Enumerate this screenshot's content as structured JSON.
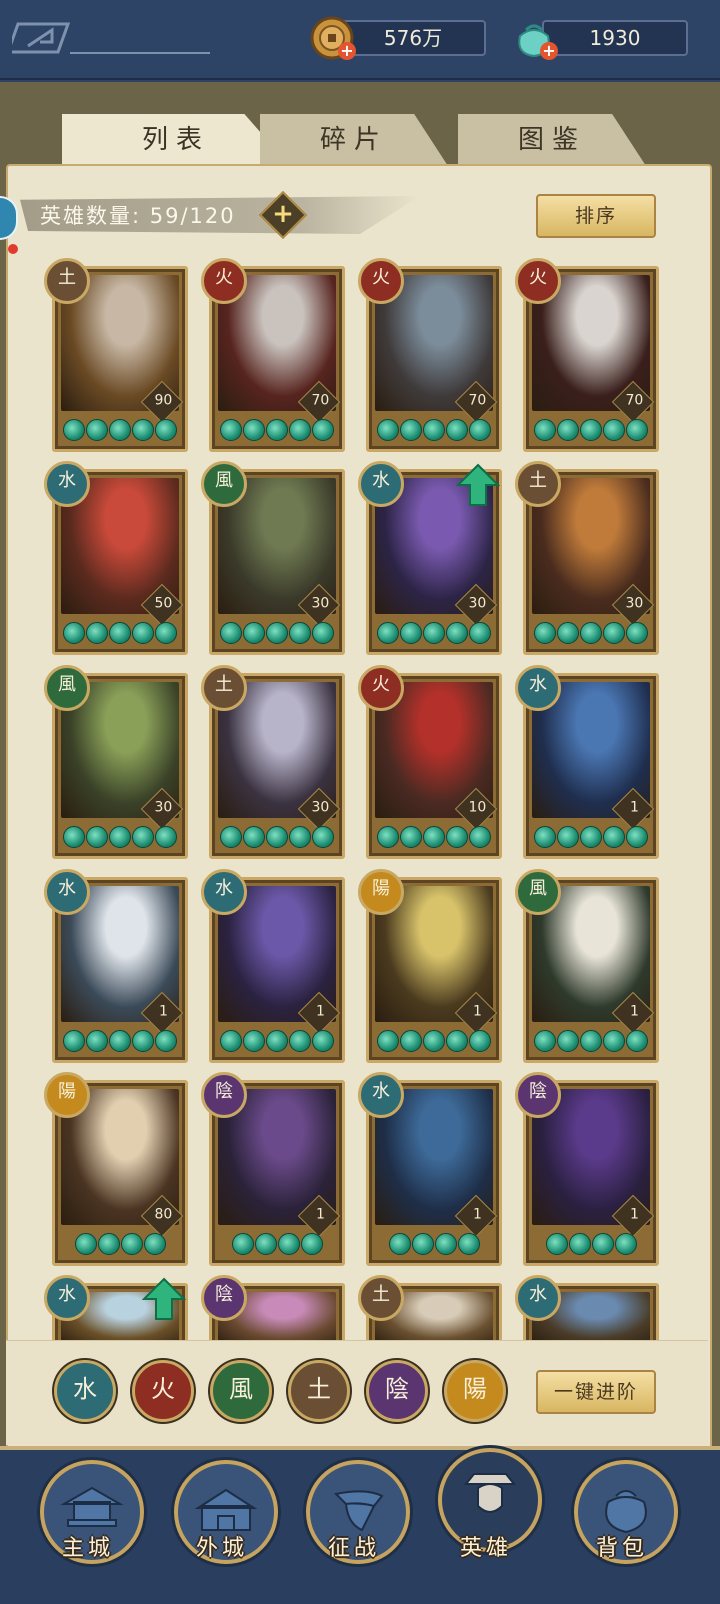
{
  "currencies": [
    {
      "name": "copper-coin",
      "value": "576万",
      "icon": "coin-icon",
      "color": "#c9923d"
    },
    {
      "name": "jade",
      "value": "1930",
      "icon": "jade-pouch-icon",
      "color": "#6dd0c4"
    }
  ],
  "tabs": [
    {
      "label": "列表",
      "active": true
    },
    {
      "label": "碎片",
      "active": false
    },
    {
      "label": "图鉴",
      "active": false
    }
  ],
  "hero_count": {
    "label": "英雄数量: 59/120"
  },
  "sort_button": "排序",
  "advance_button": "一键进阶",
  "elements": {
    "water": "水",
    "fire": "火",
    "wind": "風",
    "earth": "土",
    "yin": "陰",
    "yang": "陽"
  },
  "heroes": [
    {
      "element": "earth",
      "element_glyph": "土",
      "level": "90",
      "stars": 5,
      "upgrade": false
    },
    {
      "element": "fire",
      "element_glyph": "火",
      "level": "70",
      "stars": 5,
      "upgrade": false
    },
    {
      "element": "fire",
      "element_glyph": "火",
      "level": "70",
      "stars": 5,
      "upgrade": false
    },
    {
      "element": "fire",
      "element_glyph": "火",
      "level": "70",
      "stars": 5,
      "upgrade": false
    },
    {
      "element": "water",
      "element_glyph": "水",
      "level": "50",
      "stars": 5,
      "upgrade": false
    },
    {
      "element": "wind",
      "element_glyph": "風",
      "level": "30",
      "stars": 5,
      "upgrade": false
    },
    {
      "element": "water",
      "element_glyph": "水",
      "level": "30",
      "stars": 5,
      "upgrade": true
    },
    {
      "element": "earth",
      "element_glyph": "土",
      "level": "30",
      "stars": 5,
      "upgrade": false
    },
    {
      "element": "wind",
      "element_glyph": "風",
      "level": "30",
      "stars": 5,
      "upgrade": false
    },
    {
      "element": "earth",
      "element_glyph": "土",
      "level": "30",
      "stars": 5,
      "upgrade": false
    },
    {
      "element": "fire",
      "element_glyph": "火",
      "level": "10",
      "stars": 5,
      "upgrade": false
    },
    {
      "element": "water",
      "element_glyph": "水",
      "level": "1",
      "stars": 5,
      "upgrade": false
    },
    {
      "element": "water",
      "element_glyph": "水",
      "level": "1",
      "stars": 5,
      "upgrade": false
    },
    {
      "element": "water",
      "element_glyph": "水",
      "level": "1",
      "stars": 5,
      "upgrade": false
    },
    {
      "element": "yang",
      "element_glyph": "陽",
      "level": "1",
      "stars": 5,
      "upgrade": false
    },
    {
      "element": "wind",
      "element_glyph": "風",
      "level": "1",
      "stars": 5,
      "upgrade": false
    },
    {
      "element": "yang",
      "element_glyph": "陽",
      "level": "80",
      "stars": 4,
      "upgrade": false
    },
    {
      "element": "yin",
      "element_glyph": "陰",
      "level": "1",
      "stars": 4,
      "upgrade": false
    },
    {
      "element": "water",
      "element_glyph": "水",
      "level": "1",
      "stars": 4,
      "upgrade": false
    },
    {
      "element": "yin",
      "element_glyph": "陰",
      "level": "1",
      "stars": 4,
      "upgrade": false
    },
    {
      "element": "water",
      "element_glyph": "水",
      "level": "",
      "stars": 0,
      "upgrade": true
    },
    {
      "element": "yin",
      "element_glyph": "陰",
      "level": "",
      "stars": 0,
      "upgrade": false
    },
    {
      "element": "earth",
      "element_glyph": "土",
      "level": "",
      "stars": 0,
      "upgrade": false
    },
    {
      "element": "water",
      "element_glyph": "水",
      "level": "",
      "stars": 0,
      "upgrade": false
    }
  ],
  "filters": [
    {
      "element": "water",
      "glyph": "水"
    },
    {
      "element": "fire",
      "glyph": "火"
    },
    {
      "element": "wind",
      "glyph": "風"
    },
    {
      "element": "earth",
      "glyph": "土"
    },
    {
      "element": "yin",
      "glyph": "陰"
    },
    {
      "element": "yang",
      "glyph": "陽"
    }
  ],
  "nav": [
    {
      "label": "主城",
      "icon": "palace-icon",
      "active": false
    },
    {
      "label": "外城",
      "icon": "gate-icon",
      "active": false
    },
    {
      "label": "征战",
      "icon": "horn-icon",
      "active": false
    },
    {
      "label": "英雄",
      "icon": "hero-portrait-icon",
      "active": true
    },
    {
      "label": "背包",
      "icon": "bag-icon",
      "active": false
    }
  ]
}
